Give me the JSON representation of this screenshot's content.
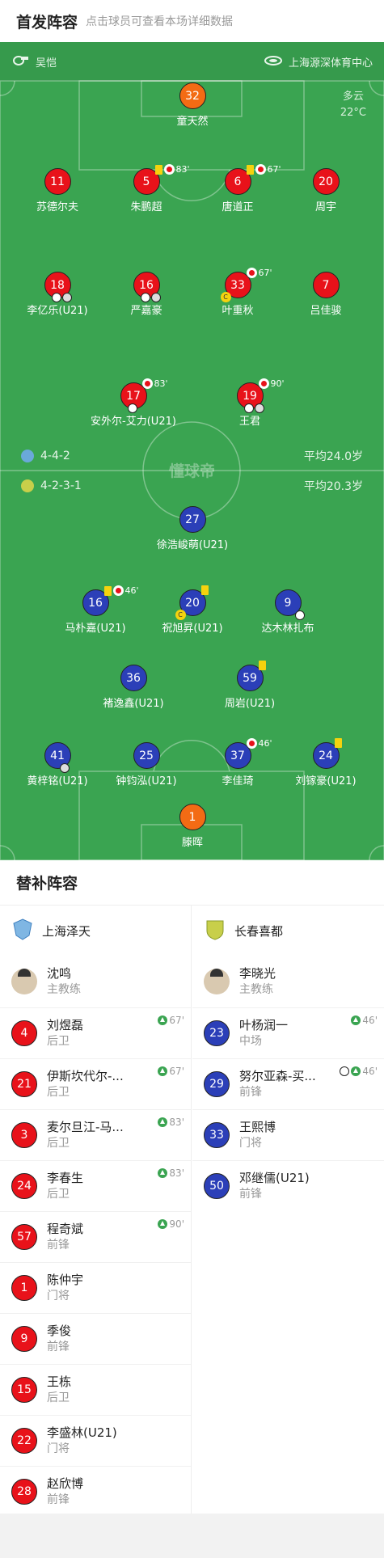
{
  "header": {
    "title": "首发阵容",
    "subtitle": "点击球员可查看本场详细数据"
  },
  "match": {
    "referee": "吴恺",
    "stadium": "上海源深体育中心",
    "weather": "多云",
    "temp": "22°C"
  },
  "home": {
    "name": "上海泽天",
    "formation": "4-4-2",
    "avg_age": "平均24.0岁",
    "color": "#e8121a"
  },
  "away": {
    "name": "长春喜都",
    "formation": "4-2-3-1",
    "avg_age": "平均20.3岁",
    "color": "#2b3fb8"
  },
  "watermark": "懂球帝",
  "pitch_players": [
    {
      "num": "32",
      "name": "童天然",
      "team": "gk"
    },
    {
      "num": "11",
      "name": "苏德尔夫",
      "team": "home"
    },
    {
      "num": "5",
      "name": "朱鹏超",
      "team": "home",
      "events": "83'"
    },
    {
      "num": "6",
      "name": "唐道正",
      "team": "home",
      "events": "67'"
    },
    {
      "num": "20",
      "name": "周宇",
      "team": "home"
    },
    {
      "num": "18",
      "name": "李亿乐(U21)",
      "team": "home"
    },
    {
      "num": "16",
      "name": "严嘉豪",
      "team": "home"
    },
    {
      "num": "33",
      "name": "叶重秋",
      "team": "home",
      "events": "67'"
    },
    {
      "num": "7",
      "name": "吕佳骏",
      "team": "home"
    },
    {
      "num": "17",
      "name": "安外尔-艾力(U21)",
      "team": "home",
      "events": "83'"
    },
    {
      "num": "19",
      "name": "王君",
      "team": "home",
      "events": "90'"
    },
    {
      "num": "27",
      "name": "徐浩峻萌(U21)",
      "team": "away"
    },
    {
      "num": "16",
      "name": "马朴嘉(U21)",
      "team": "away",
      "events": "46'"
    },
    {
      "num": "20",
      "name": "祝旭昇(U21)",
      "team": "away"
    },
    {
      "num": "9",
      "name": "达木林扎布",
      "team": "away"
    },
    {
      "num": "36",
      "name": "褚逸鑫(U21)",
      "team": "away"
    },
    {
      "num": "59",
      "name": "周岩(U21)",
      "team": "away"
    },
    {
      "num": "41",
      "name": "黄梓铭(U21)",
      "team": "away"
    },
    {
      "num": "25",
      "name": "钟钧泓(U21)",
      "team": "away"
    },
    {
      "num": "37",
      "name": "李佳琦",
      "team": "away",
      "events": "46'"
    },
    {
      "num": "24",
      "name": "刘镓豪(U21)",
      "team": "away"
    },
    {
      "num": "1",
      "name": "滕晖",
      "team": "gk"
    }
  ],
  "bench": {
    "title": "替补阵容",
    "home_coach": {
      "name": "沈鸣",
      "role": "主教练"
    },
    "away_coach": {
      "name": "李晓光",
      "role": "主教练"
    },
    "home_subs": [
      {
        "num": "4",
        "name": "刘煜磊",
        "pos": "后卫",
        "time": "67'"
      },
      {
        "num": "21",
        "name": "伊斯坎代尔-...",
        "pos": "后卫",
        "time": "67'"
      },
      {
        "num": "3",
        "name": "麦尔旦江-马...",
        "pos": "后卫",
        "time": "83'"
      },
      {
        "num": "24",
        "name": "李春生",
        "pos": "后卫",
        "time": "83'"
      },
      {
        "num": "57",
        "name": "程奇斌",
        "pos": "前锋",
        "time": "90'"
      },
      {
        "num": "1",
        "name": "陈仲宇",
        "pos": "门将",
        "time": ""
      },
      {
        "num": "9",
        "name": "季俊",
        "pos": "前锋",
        "time": ""
      },
      {
        "num": "15",
        "name": "王栋",
        "pos": "后卫",
        "time": ""
      },
      {
        "num": "22",
        "name": "李盛林(U21)",
        "pos": "门将",
        "time": ""
      },
      {
        "num": "28",
        "name": "赵欣博",
        "pos": "前锋",
        "time": ""
      }
    ],
    "away_subs": [
      {
        "num": "23",
        "name": "叶杨润一",
        "pos": "中场",
        "time": "46'"
      },
      {
        "num": "29",
        "name": "努尔亚森-买...",
        "pos": "前锋",
        "time": "46'"
      },
      {
        "num": "33",
        "name": "王熙博",
        "pos": "门将",
        "time": ""
      },
      {
        "num": "50",
        "name": "邓继儒(U21)",
        "pos": "前锋",
        "time": ""
      }
    ]
  }
}
